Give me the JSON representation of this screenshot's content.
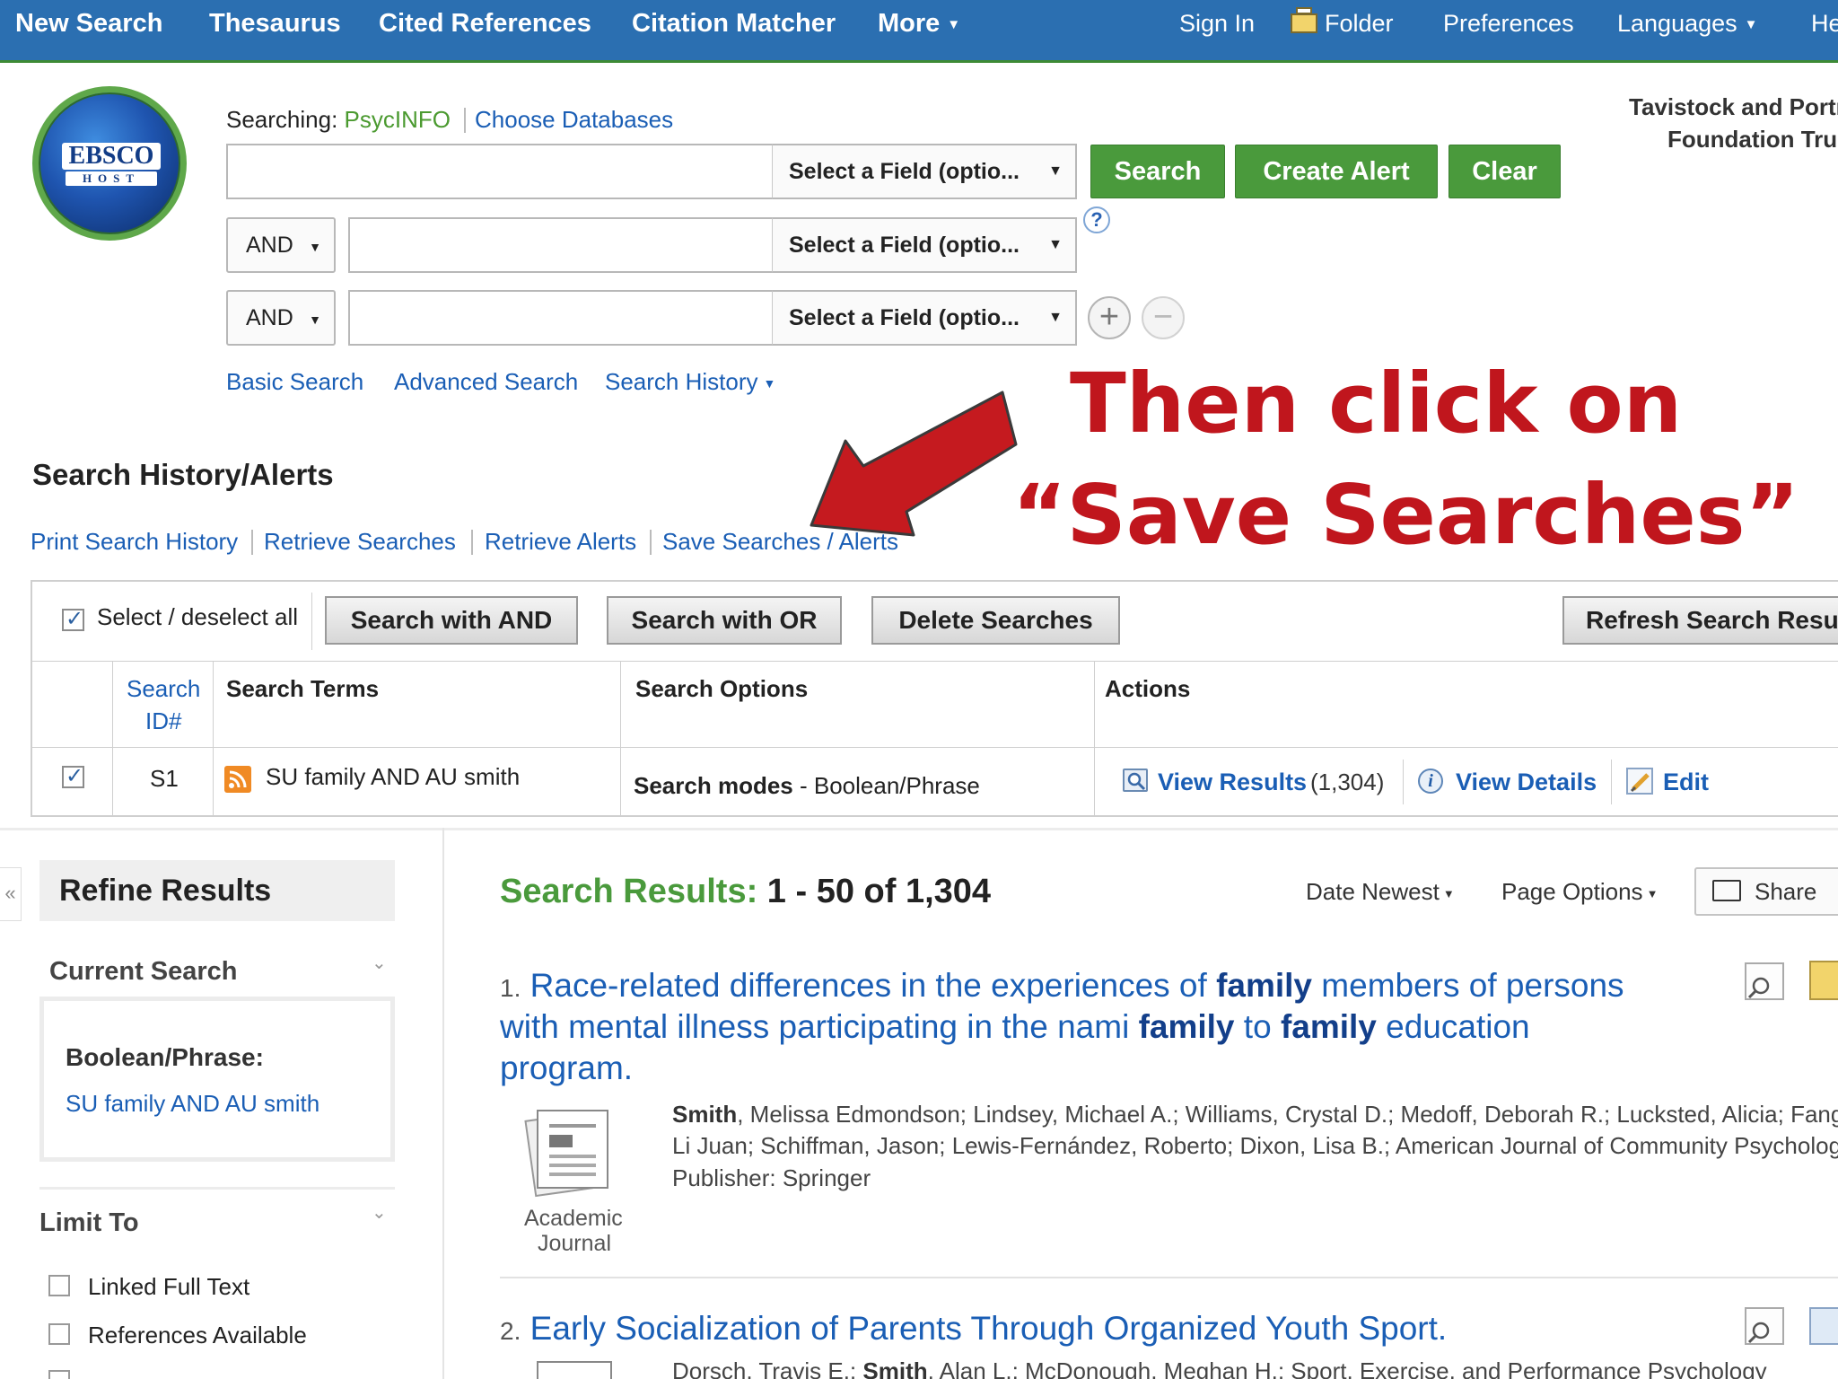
{
  "topnav": {
    "left": [
      "New Search",
      "Thesaurus",
      "Cited References",
      "Citation Matcher",
      "More"
    ],
    "right": {
      "sign_in": "Sign In",
      "folder": "Folder",
      "preferences": "Preferences",
      "languages": "Languages",
      "help": "He"
    }
  },
  "search": {
    "searching_label": "Searching:",
    "database": "PsycINFO",
    "choose_databases": "Choose Databases",
    "field_placeholder": "Select a Field (optio...",
    "bool_ops": [
      "AND",
      "AND"
    ],
    "buttons": {
      "search": "Search",
      "create_alert": "Create Alert",
      "clear": "Clear"
    },
    "help_symbol": "?",
    "links": {
      "basic": "Basic Search",
      "advanced": "Advanced Search",
      "history": "Search History"
    }
  },
  "institution": {
    "line1": "Tavistock and Portr",
    "line2": "Foundation Trus"
  },
  "logo": {
    "line1": "EBSCO",
    "line2": "HOST"
  },
  "annotation": {
    "line1": "Then click on",
    "line2": "“Save Searches”"
  },
  "history": {
    "title": "Search History/Alerts",
    "links": [
      "Print Search History",
      "Retrieve Searches",
      "Retrieve Alerts",
      "Save Searches / Alerts"
    ],
    "select_all": "Select / deselect all",
    "buttons": {
      "and": "Search with AND",
      "or": "Search with OR",
      "delete": "Delete Searches",
      "refresh": "Refresh Search Resu"
    },
    "headers": {
      "id_line1": "Search",
      "id_line2": "ID#",
      "terms": "Search Terms",
      "options": "Search Options",
      "actions": "Actions"
    },
    "row": {
      "id": "S1",
      "terms": "SU family AND AU smith",
      "options_label": "Search modes",
      "options_value": "Boolean/Phrase",
      "view_results": "View Results",
      "count": "(1,304)",
      "view_details": "View Details",
      "edit": "Edit"
    }
  },
  "sidebar": {
    "collapse": "«",
    "refine_title": "Refine Results",
    "current_search": "Current Search",
    "boolean_label": "Boolean/Phrase:",
    "boolean_value": "SU family AND AU smith",
    "limit_to": "Limit To",
    "limits": [
      "Linked Full Text",
      "References Available"
    ]
  },
  "results": {
    "label": "Search Results:",
    "range": "1 - 50 of 1,304",
    "sort": "Date Newest",
    "page_options": "Page Options",
    "share": "Share",
    "items": [
      {
        "num": "1.",
        "title_line1_a": "Race-related differences in the experiences of ",
        "title_line1_b": "family",
        "title_line1_c": " members of persons",
        "title_line2_a": "with mental illness participating in the nami ",
        "title_line2_b": "family",
        "title_line2_c": " to ",
        "title_line2_d": "family",
        "title_line2_e": " education",
        "title_line3": "program.",
        "authors_bold": "Smith",
        "authors_line1": ", Melissa Edmondson; Lindsey, Michael A.; Williams, Crystal D.; Medoff, Deborah R.; Lucksted, Alicia; Fang",
        "authors_line2": "Li Juan; Schiffman, Jason; Lewis-Fernández, Roberto; Dixon, Lisa B.; American Journal of Community Psycholog",
        "publisher": "Publisher: Springer",
        "type_line1": "Academic",
        "type_line2": "Journal"
      },
      {
        "num": "2.",
        "title": "Early Socialization of Parents Through Organized Youth Sport.",
        "authors_a": "Dorsch, Travis E.; ",
        "authors_bold": "Smith",
        "authors_b": ", Alan L.; McDonough, Meghan H.; Sport, Exercise, and Performance Psychology"
      }
    ]
  },
  "colors": {
    "nav_blue": "#2b6fb1",
    "green": "#4a9a3c",
    "link_blue": "#1a5eb5",
    "annotation_red": "#c0161d"
  }
}
